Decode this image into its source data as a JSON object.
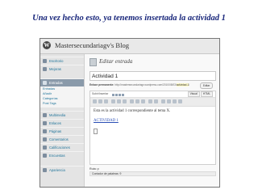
{
  "slide": {
    "title": "Una vez hecho esto, ya tenemos insertada la actividad 1"
  },
  "header": {
    "logo_glyph": "W",
    "blog_name": "Mastersecundariagv's Blog"
  },
  "sidebar": {
    "items": [
      {
        "label": "Escritorio",
        "icon": "dashboard-icon"
      },
      {
        "label": "Mejoras",
        "icon": "upgrade-icon"
      },
      {
        "label": "Entradas",
        "icon": "posts-icon"
      },
      {
        "label": "Multimedia",
        "icon": "media-icon"
      },
      {
        "label": "Enlaces",
        "icon": "links-icon"
      },
      {
        "label": "Páginas",
        "icon": "pages-icon"
      },
      {
        "label": "Comentarios",
        "icon": "comments-icon"
      },
      {
        "label": "Calificaciones",
        "icon": "ratings-icon"
      },
      {
        "label": "Encuestas",
        "icon": "polls-icon"
      },
      {
        "label": "Apariencia",
        "icon": "appearance-icon"
      }
    ],
    "subitems": [
      "Entradas",
      "Añadir",
      "Categorías",
      "Post Tags"
    ]
  },
  "main": {
    "page_title": "Editar entrada",
    "post_title": "Actividad 1",
    "permalink_label": "Enlace permanente:",
    "permalink_url": "http://mastersecundariagv.wordpress.com/2010/08/03/",
    "permalink_slug": "actividad-1",
    "permalink_tail": "/",
    "edit_button": "Editar",
    "upload_label": "Subir/Insertar",
    "tab_visual": "Visual",
    "tab_html": "HTML",
    "content_paragraph": "Esta es la actividad 1 correspondiente al tema X.",
    "content_link": "ACTIVIDAD 1",
    "path_label": "Ruta: p",
    "word_count": "Contador de palabras: 9"
  }
}
